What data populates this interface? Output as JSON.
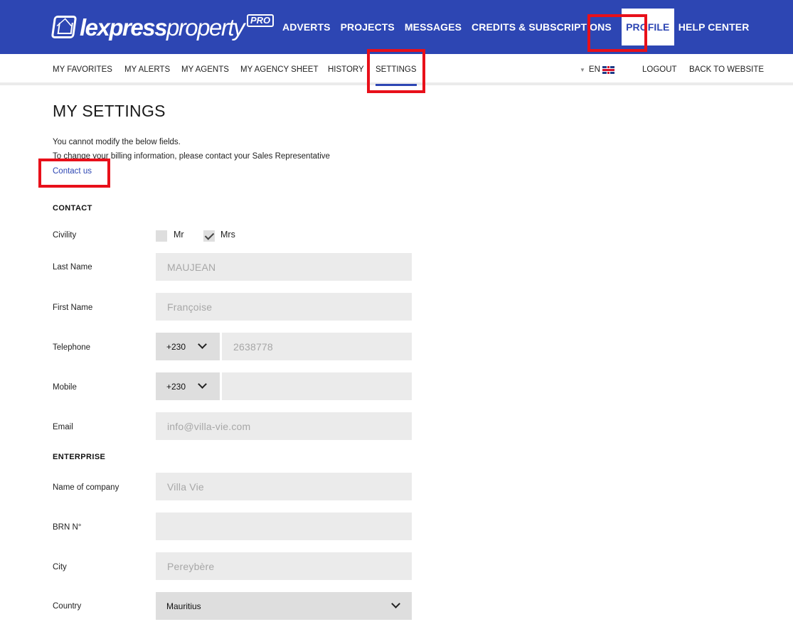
{
  "header": {
    "logo": {
      "text_main": "lexpress",
      "text_rest": "property",
      "badge": "PRO"
    },
    "nav": [
      {
        "label": "ADVERTS"
      },
      {
        "label": "PROJECTS"
      },
      {
        "label": "MESSAGES"
      },
      {
        "label": "CREDITS & SUBSCRIPTIONS"
      },
      {
        "label": "PROFILE",
        "active": true
      },
      {
        "label": "HELP CENTER"
      }
    ],
    "brand_color": "#2d46b3"
  },
  "subnav": {
    "items": [
      {
        "label": "MY FAVORITES"
      },
      {
        "label": "MY ALERTS"
      },
      {
        "label": "MY AGENTS"
      },
      {
        "label": "MY AGENCY SHEET"
      },
      {
        "label": "HISTORY"
      },
      {
        "label": "SETTINGS",
        "active": true
      }
    ],
    "language": "EN",
    "language_flag": "uk-flag-icon",
    "logout": "LOGOUT",
    "back": "BACK TO WEBSITE"
  },
  "page": {
    "title": "MY SETTINGS",
    "info_line1": "You cannot modify the below fields.",
    "info_line2": "To change your billing information, please contact your Sales Representative",
    "contact_link": "Contact us"
  },
  "contact": {
    "section_title": "CONTACT",
    "civility_label": "Civility",
    "civility_options": [
      {
        "label": "Mr",
        "checked": false
      },
      {
        "label": "Mrs",
        "checked": true
      }
    ],
    "last_name_label": "Last Name",
    "last_name_value": "MAUJEAN",
    "first_name_label": "First Name",
    "first_name_value": "Françoise",
    "telephone_label": "Telephone",
    "telephone_prefix": "+230",
    "telephone_value": "2638778",
    "mobile_label": "Mobile",
    "mobile_prefix": "+230",
    "mobile_value": "",
    "email_label": "Email",
    "email_value": "info@villa-vie.com"
  },
  "enterprise": {
    "section_title": "ENTERPRISE",
    "company_label": "Name of company",
    "company_value": "Villa Vie",
    "brn_label": "BRN N°",
    "brn_value": "",
    "city_label": "City",
    "city_value": "Pereybère",
    "country_label": "Country",
    "country_value": "Mauritius"
  },
  "highlight_color": "#e8101a"
}
